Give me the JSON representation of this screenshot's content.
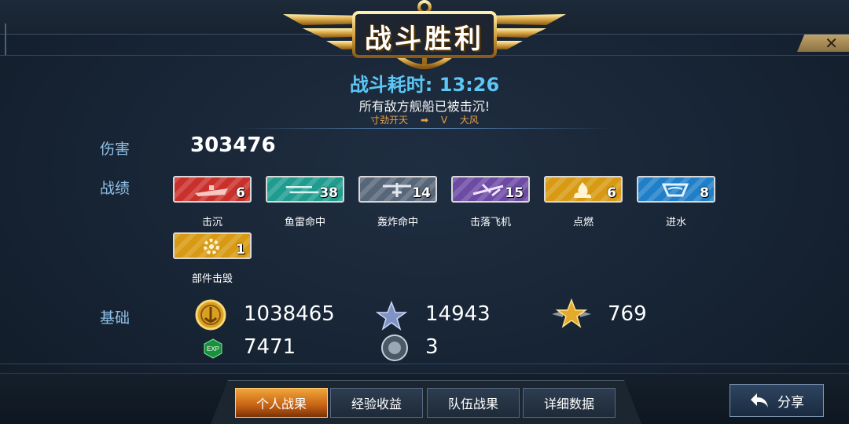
{
  "header": {
    "title": "战斗胜利",
    "close_icon": "close-icon"
  },
  "battle": {
    "time": "战斗耗时: 13:26",
    "subtitle": "所有敌方舰船已被击沉!",
    "player": "寸劲开天",
    "vs": "V",
    "opponent": "大风"
  },
  "damage": {
    "label": "伤害",
    "value": "303476"
  },
  "record": {
    "label": "战绩",
    "badges": [
      {
        "name": "击沉",
        "count": "6",
        "color": "#c9302b",
        "icon": "ship-icon"
      },
      {
        "name": "鱼雷命中",
        "count": "38",
        "color": "#1f9c8f",
        "icon": "torpedo-icon"
      },
      {
        "name": "轰炸命中",
        "count": "14",
        "color": "#58667a",
        "icon": "bomb-icon"
      },
      {
        "name": "击落飞机",
        "count": "15",
        "color": "#6d4aa3",
        "icon": "plane-icon"
      },
      {
        "name": "点燃",
        "count": "6",
        "color": "#d79a12",
        "icon": "fire-icon"
      },
      {
        "name": "进水",
        "count": "8",
        "color": "#1f7fc8",
        "icon": "water-icon"
      },
      {
        "name": "部件击毁",
        "count": "1",
        "color": "#d79a12",
        "icon": "gear-icon"
      }
    ]
  },
  "basics": {
    "label": "基础",
    "coins": "1038465",
    "blue_star": "14943",
    "gold_star": "769",
    "exp": "7471",
    "medal": "3"
  },
  "tabs": [
    "个人战果",
    "经验收益",
    "队伍战果",
    "详细数据"
  ],
  "share_label": "分享"
}
